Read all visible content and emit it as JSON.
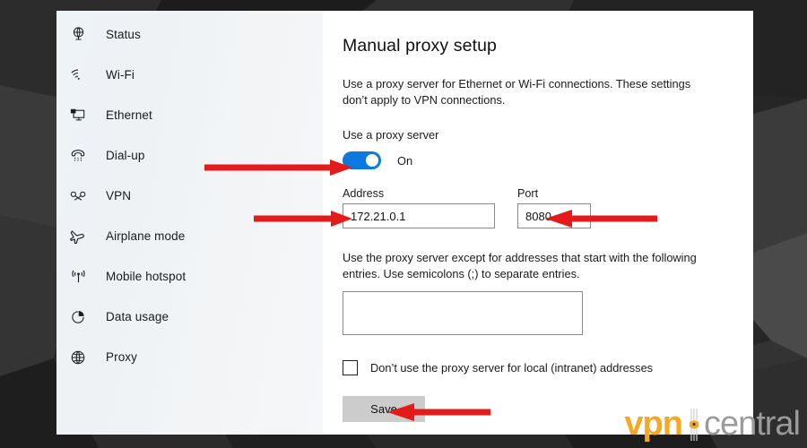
{
  "window": {
    "sidebar": {
      "items": [
        {
          "label": "Status",
          "icon": "status-icon"
        },
        {
          "label": "Wi-Fi",
          "icon": "wifi-icon"
        },
        {
          "label": "Ethernet",
          "icon": "ethernet-icon"
        },
        {
          "label": "Dial-up",
          "icon": "dialup-icon"
        },
        {
          "label": "VPN",
          "icon": "vpn-icon"
        },
        {
          "label": "Airplane mode",
          "icon": "airplane-icon"
        },
        {
          "label": "Mobile hotspot",
          "icon": "hotspot-icon"
        },
        {
          "label": "Data usage",
          "icon": "data-usage-icon"
        },
        {
          "label": "Proxy",
          "icon": "globe-icon"
        }
      ]
    },
    "content": {
      "title": "Manual proxy setup",
      "description": "Use a proxy server for Ethernet or Wi-Fi connections. These settings don’t apply to VPN connections.",
      "proxy_toggle": {
        "label": "Use a proxy server",
        "state": "On",
        "on": true,
        "accent_color": "#0a7ae0"
      },
      "address": {
        "label": "Address",
        "value": "172.21.0.1",
        "placeholder": ""
      },
      "port": {
        "label": "Port",
        "value": "8080",
        "placeholder": ""
      },
      "exceptions": {
        "description": "Use the proxy server except for addresses that start with the following entries. Use semicolons (;) to separate entries.",
        "value": "",
        "placeholder": ""
      },
      "local_checkbox": {
        "label": "Don’t use the proxy server for local (intranet) addresses",
        "checked": false
      },
      "save_label": "Save"
    }
  },
  "annotations": {
    "arrow_color": "#e51b1b",
    "arrows": [
      {
        "name": "arrow-to-proxy-toggle",
        "target": "proxy-toggle"
      },
      {
        "name": "arrow-to-address-field",
        "target": "address-input"
      },
      {
        "name": "arrow-to-port-field",
        "target": "port-input"
      },
      {
        "name": "arrow-to-save-button",
        "target": "save-button"
      }
    ]
  },
  "watermark": {
    "brand_primary": "vpn",
    "brand_secondary": "central",
    "primary_color": "#f6a823",
    "secondary_color": "#9b9b9b"
  }
}
